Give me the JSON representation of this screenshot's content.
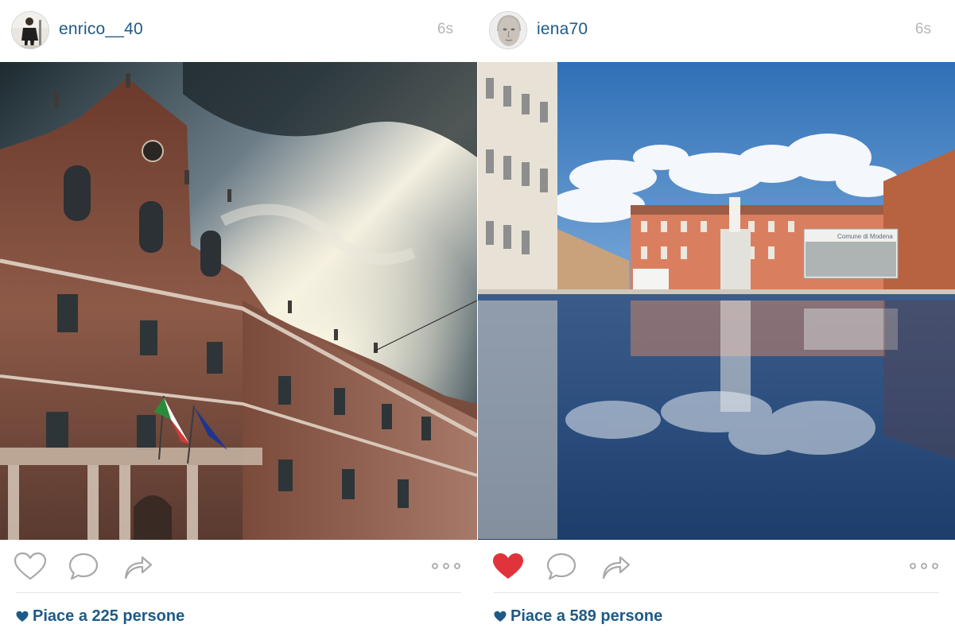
{
  "posts": [
    {
      "username": "enrico__40",
      "timestamp": "6s",
      "liked": false,
      "likes_text": "Piace a 225 persone",
      "photo": "palazzo-ducale-dramatic-sky"
    },
    {
      "username": "iena70",
      "timestamp": "6s",
      "liked": true,
      "likes_text": "Piace a 589 persone",
      "photo": "piazza-reflection-blue-sky",
      "sign_text": "Comune di Modena"
    }
  ],
  "colors": {
    "username": "#1e5a86",
    "timestamp": "#b6b6b6",
    "liked_heart": "#e0333c",
    "icon_stroke": "#a8a8a8"
  },
  "icons": {
    "like": "heart-outline-icon",
    "liked": "heart-filled-icon",
    "comment": "speech-bubble-icon",
    "share": "share-arrow-icon",
    "more": "ellipsis-icon",
    "likes": "small-heart-icon"
  }
}
